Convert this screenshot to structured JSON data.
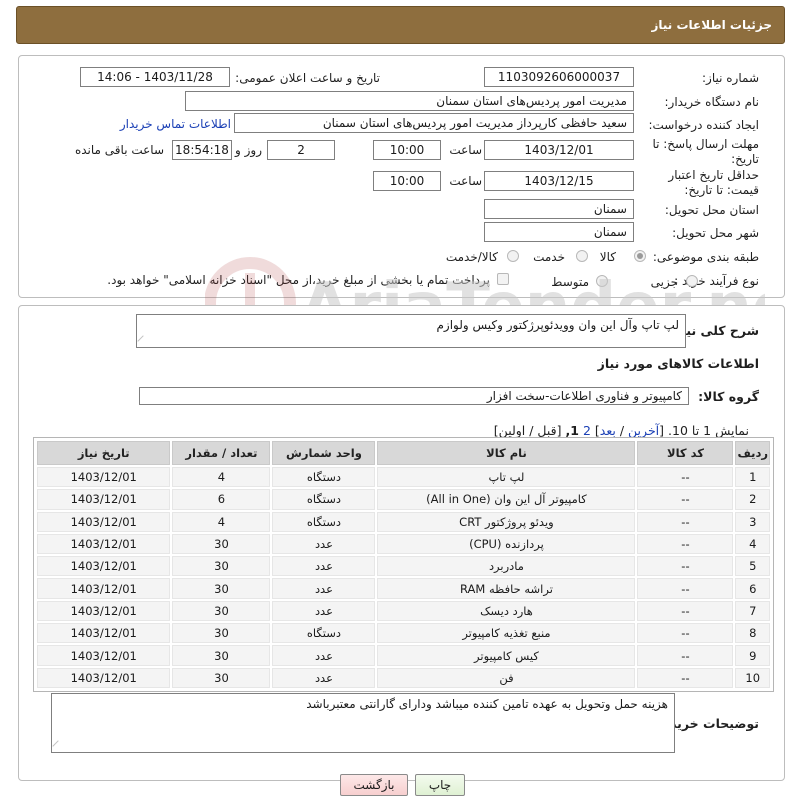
{
  "header": {
    "title": "جزئیات اطلاعات نیاز"
  },
  "form": {
    "need_number_label": "شماره نیاز:",
    "need_number": "1103092606000037",
    "announce_label": "تاریخ و ساعت اعلان عمومی:",
    "announce_value": "1403/11/28 - 14:06",
    "buyer_org_label": "نام دستگاه خریدار:",
    "buyer_org": "مدیریت امور پردیس‌های استان سمنان",
    "creator_label": "ایجاد کننده درخواست:",
    "creator": "سعید حافظی کارپرداز مدیریت امور پردیس‌های استان سمنان",
    "contact_link": "اطلاعات تماس خریدار",
    "deadline_label": "مهلت ارسال پاسخ: تا تاریخ:",
    "deadline_date": "1403/12/01",
    "time_label": "ساعت",
    "deadline_time": "10:00",
    "days_value": "2",
    "days_label": "روز و",
    "remaining_time": "18:54:18",
    "remaining_label": "ساعت باقی مانده",
    "validity_label": "حداقل تاریخ اعتبار قیمت: تا تاریخ:",
    "validity_date": "1403/12/15",
    "validity_time": "10:00",
    "province_label": "استان محل تحویل:",
    "province": "سمنان",
    "city_label": "شهر محل تحویل:",
    "city": "سمنان",
    "category_label": "طبقه بندی موضوعی:",
    "category_options": [
      "کالا",
      "خدمت",
      "کالا/خدمت"
    ],
    "process_label": "نوع فرآیند خرید :",
    "process_options": [
      "جزیی",
      "متوسط"
    ],
    "payment_note": "پرداخت تمام یا بخشی از مبلغ خرید،از محل \"اسناد خزانه اسلامی\" خواهد بود."
  },
  "summary": {
    "label": "شرح کلی نیاز:",
    "text": "لپ تاپ وآل این وان وویدئوپرژکتور وکیس ولوازم"
  },
  "goods": {
    "section_title": "اطلاعات کالاهای مورد نیاز",
    "group_label": "گروه کالا:",
    "group_value": "کامپیوتر و فناوری اطلاعات-سخت افزار",
    "pager": {
      "prefix": "نمایش 1 تا 10.",
      "open_bracket": "[",
      "last": "آخرین",
      "sep": "/",
      "next": "بعد",
      "close_bracket": "]",
      "page_link": "2",
      "current": "1,",
      "tail": "[قبل / اولین]"
    },
    "columns": [
      "ردیف",
      "کد کالا",
      "نام کالا",
      "واحد شمارش",
      "تعداد / مقدار",
      "تاریخ نیاز"
    ],
    "rows": [
      [
        "1",
        "--",
        "لپ تاپ",
        "دستگاه",
        "4",
        "1403/12/01"
      ],
      [
        "2",
        "--",
        "کامپیوتر آل این وان (All in One)",
        "دستگاه",
        "6",
        "1403/12/01"
      ],
      [
        "3",
        "--",
        "ویدئو پروژکتور CRT",
        "دستگاه",
        "4",
        "1403/12/01"
      ],
      [
        "4",
        "--",
        "پردازنده (CPU)",
        "عدد",
        "30",
        "1403/12/01"
      ],
      [
        "5",
        "--",
        "مادربرد",
        "عدد",
        "30",
        "1403/12/01"
      ],
      [
        "6",
        "--",
        "تراشه حافظه RAM",
        "عدد",
        "30",
        "1403/12/01"
      ],
      [
        "7",
        "--",
        "هارد دیسک",
        "عدد",
        "30",
        "1403/12/01"
      ],
      [
        "8",
        "--",
        "منبع تغذیه کامپیوتر",
        "دستگاه",
        "30",
        "1403/12/01"
      ],
      [
        "9",
        "--",
        "کیس کامپیوتر",
        "عدد",
        "30",
        "1403/12/01"
      ],
      [
        "10",
        "--",
        "فن",
        "عدد",
        "30",
        "1403/12/01"
      ]
    ]
  },
  "buyer_notes": {
    "label": "توضیحات خریدار:",
    "text": "هزینه حمل وتحویل به عهده تامین کننده میباشد ودارای گارانتی معتبرباشد"
  },
  "buttons": {
    "print": "چاپ",
    "back": "بازگشت"
  },
  "watermark": {
    "text": "AriaTender.neT"
  },
  "colors": {
    "header": "#8e6e3e",
    "link": "#1a3fb5"
  }
}
